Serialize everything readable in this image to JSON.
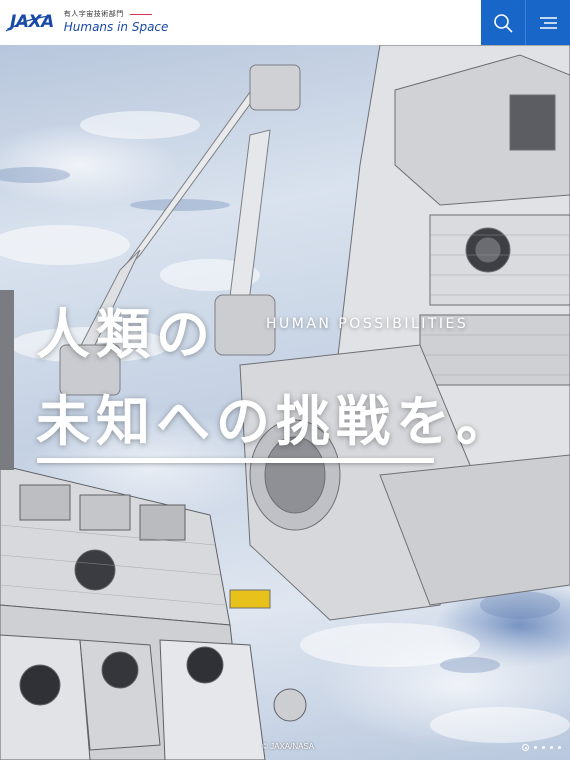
{
  "header": {
    "logo_text": "JAXA",
    "department_jp": "有人宇宙技術部門",
    "department_en": "Humans in Space",
    "search_icon": "search-icon",
    "menu_icon": "hamburger-menu-icon"
  },
  "hero": {
    "headline_line1": "人類の",
    "headline_line2": "未知への挑戦を。",
    "subtitle": "HUMAN POSSIBILITIES",
    "credit": "© JAXA/NASA",
    "carousel": {
      "total": 5,
      "active_index": 0
    }
  },
  "colors": {
    "brand_blue": "#1766c8",
    "logo_blue": "#1a4aa8",
    "accent_red": "#d6344a"
  }
}
